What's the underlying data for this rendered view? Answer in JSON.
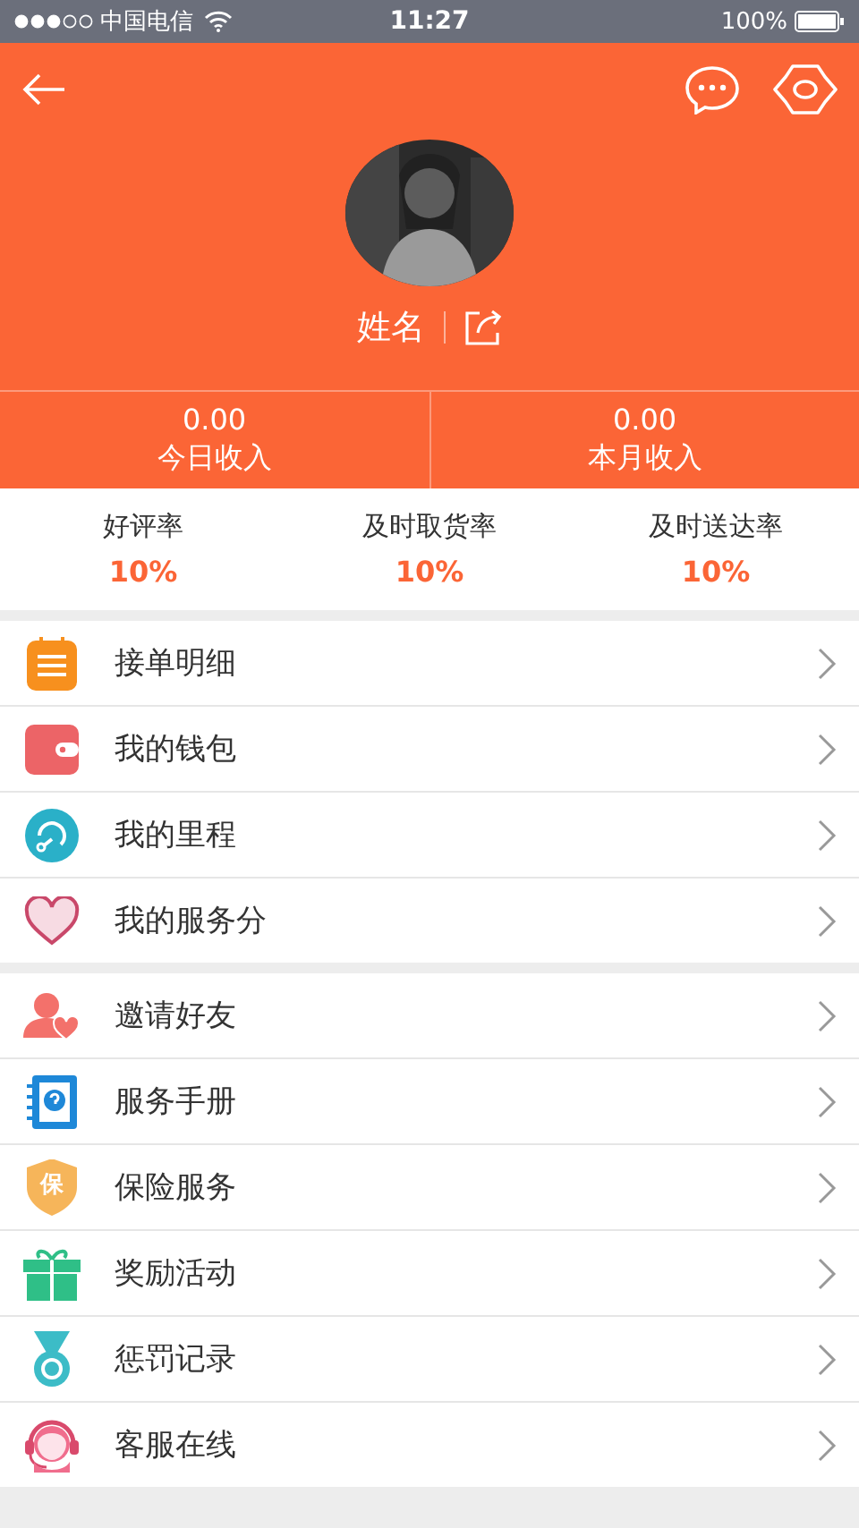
{
  "status_bar": {
    "carrier": "中国电信",
    "time": "11:27",
    "battery": "100%"
  },
  "profile": {
    "name": "姓名"
  },
  "income": [
    {
      "value": "0.00",
      "label": "今日收入"
    },
    {
      "value": "0.00",
      "label": "本月收入"
    }
  ],
  "rates": [
    {
      "label": "好评率",
      "value": "10%"
    },
    {
      "label": "及时取货率",
      "value": "10%"
    },
    {
      "label": "及时送达率",
      "value": "10%"
    }
  ],
  "menu_groups": [
    [
      {
        "kind": "list",
        "label": "接单明细"
      },
      {
        "kind": "wallet",
        "label": "我的钱包"
      },
      {
        "kind": "gauge",
        "label": "我的里程"
      },
      {
        "kind": "heart",
        "label": "我的服务分"
      }
    ],
    [
      {
        "kind": "invite",
        "label": "邀请好友"
      },
      {
        "kind": "manual",
        "label": "服务手册"
      },
      {
        "kind": "shield",
        "label": "保险服务",
        "icon_text": "保"
      },
      {
        "kind": "gift",
        "label": "奖励活动"
      },
      {
        "kind": "medal",
        "label": "惩罚记录"
      },
      {
        "kind": "headset",
        "label": "客服在线"
      }
    ]
  ]
}
